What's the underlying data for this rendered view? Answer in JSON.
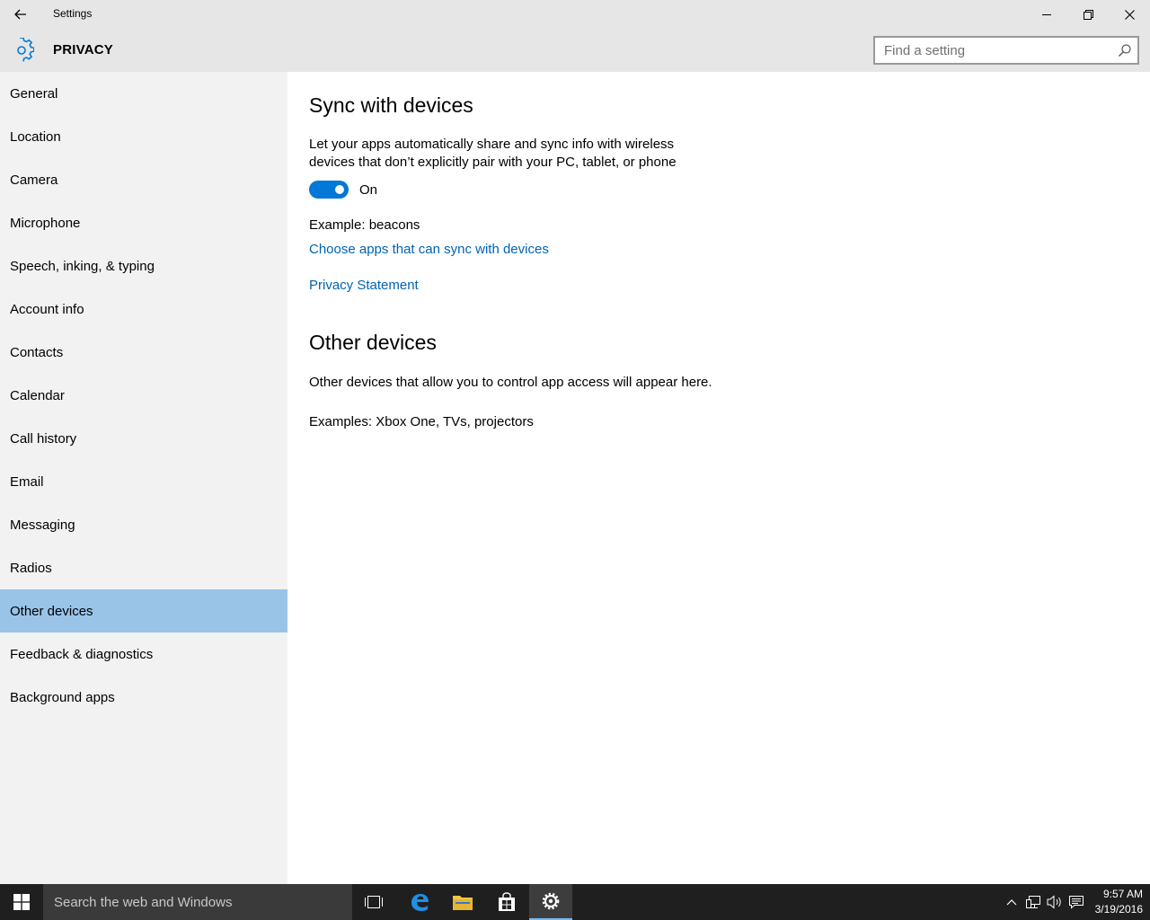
{
  "window": {
    "title": "Settings"
  },
  "header": {
    "section": "PRIVACY",
    "search_placeholder": "Find a setting"
  },
  "sidebar": {
    "items": [
      {
        "label": "General"
      },
      {
        "label": "Location"
      },
      {
        "label": "Camera"
      },
      {
        "label": "Microphone"
      },
      {
        "label": "Speech, inking, & typing"
      },
      {
        "label": "Account info"
      },
      {
        "label": "Contacts"
      },
      {
        "label": "Calendar"
      },
      {
        "label": "Call history"
      },
      {
        "label": "Email"
      },
      {
        "label": "Messaging"
      },
      {
        "label": "Radios"
      },
      {
        "label": "Other devices"
      },
      {
        "label": "Feedback & diagnostics"
      },
      {
        "label": "Background apps"
      }
    ],
    "selected": "Other devices"
  },
  "content": {
    "sync_heading": "Sync with devices",
    "sync_desc_line1": "Let your apps automatically share and sync info with wireless",
    "sync_desc_line2": "devices that don’t explicitly pair with your PC, tablet, or phone",
    "toggle_state": "On",
    "example": "Example: beacons",
    "choose_apps_link": "Choose apps that can sync with devices",
    "privacy_link": "Privacy Statement",
    "other_heading": "Other devices",
    "other_desc": "Other devices that allow you to control app access will appear here.",
    "other_examples": "Examples: Xbox One, TVs, projectors"
  },
  "taskbar": {
    "search_placeholder": "Search the web and Windows",
    "time": "9:57 AM",
    "date": "3/19/2016"
  },
  "colors": {
    "accent": "#0078d7",
    "link": "#0063b1",
    "selected_nav": "#99c4e8"
  }
}
